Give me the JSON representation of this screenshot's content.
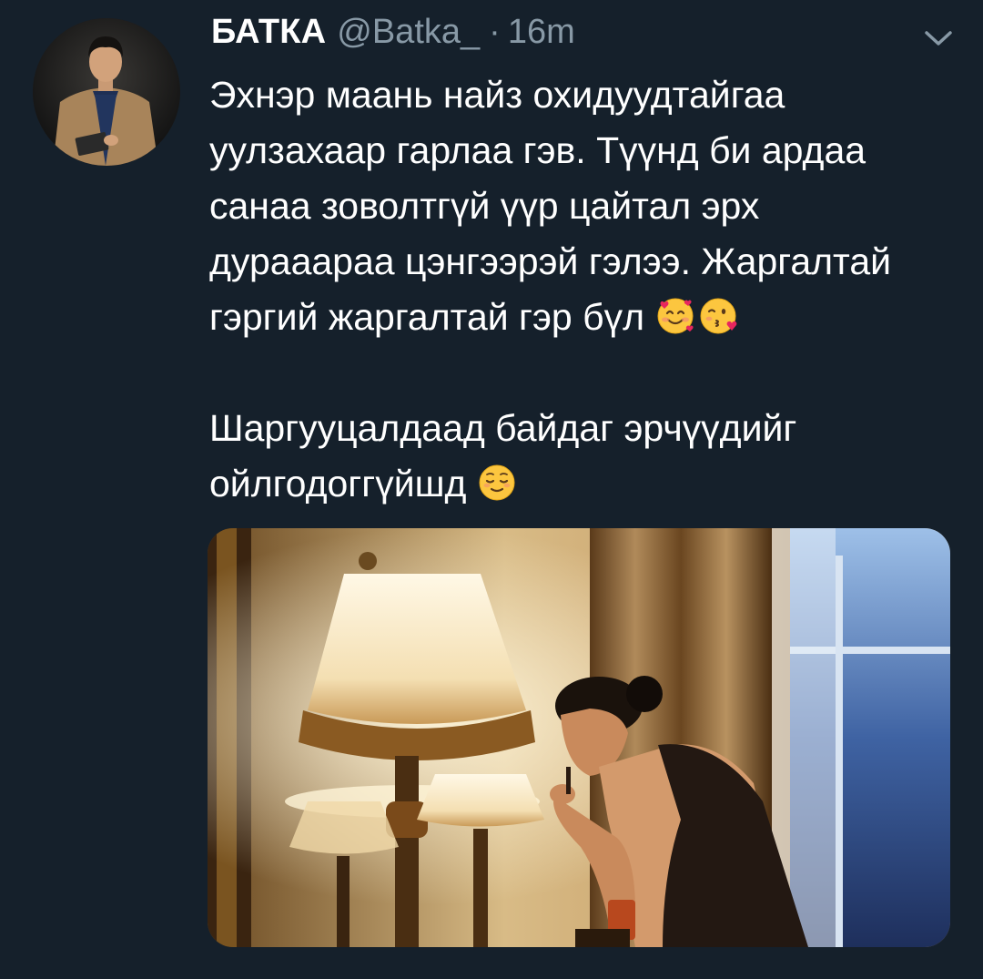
{
  "tweet": {
    "display_name": "БАТКА",
    "handle": "@Batka_",
    "separator": "·",
    "time": "16m",
    "text_lines_p1": [
      "Эхнэр маань найз охидуудтайгаа",
      "уулзахаар гарлаа гэв. Түүнд би ардаа",
      "санаа зоволтгүй үүр цайтал эрх",
      "дурааараа цэнгээрэй гэлээ. Жаргалтай",
      "гэргий жаргалтай гэр бүл"
    ],
    "text_lines_p2": [
      "Шаргууцалдаад байдаг эрчүүдийг",
      "ойлгодоггүйшд"
    ],
    "emojis": {
      "p1_end": [
        "smiling-face-with-hearts-icon",
        "face-blowing-kiss-icon"
      ],
      "p2_end": [
        "relieved-face-icon"
      ]
    },
    "icons": {
      "menu": "chevron-down-icon"
    },
    "colors": {
      "background": "#15202b",
      "text_primary": "#ffffff",
      "text_secondary": "#8899a6"
    }
  }
}
